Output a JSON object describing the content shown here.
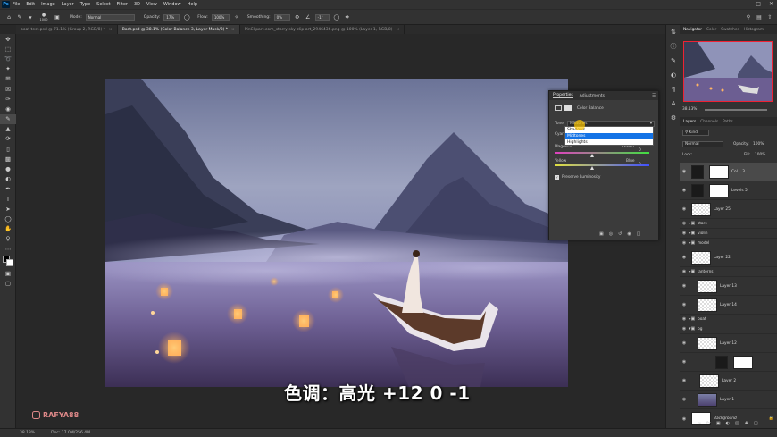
{
  "app": {
    "logo": "Ps"
  },
  "menu": [
    "File",
    "Edit",
    "Image",
    "Layer",
    "Type",
    "Select",
    "Filter",
    "3D",
    "View",
    "Window",
    "Help"
  ],
  "options": {
    "brush_size": "1000",
    "mode_label": "Mode:",
    "mode_value": "Normal",
    "opacity_label": "Opacity:",
    "opacity_value": "17%",
    "flow_label": "Flow:",
    "flow_value": "100%",
    "smoothing_label": "Smoothing:",
    "smoothing_value": "0%",
    "angle_value": "-1°"
  },
  "tabs": [
    {
      "label": "boat test.psd @ 71.1% (Group 2, RGB/8) *"
    },
    {
      "label": "Boat.psd @ 38.1% (Color Balance 3, Layer Mask/8) *"
    },
    {
      "label": "PinClipart.com_starry-sky-clip-art_2946436.png @ 100% (Layer 1, RGB/8)"
    }
  ],
  "properties": {
    "tab_properties": "Properties",
    "tab_adjustments": "Adjustments",
    "title": "Color Balance",
    "tone_label": "Tone:",
    "tone_value": "Midtones",
    "cyan": "Cyan",
    "red": "Red",
    "red_value": "",
    "magenta": "Magenta",
    "green": "Green",
    "green_value": "0",
    "yellow": "Yellow",
    "blue": "Blue",
    "blue_value": "0",
    "preserve": "Preserve Luminosity",
    "preserve_checked": true,
    "tone_options": [
      "Shadows",
      "Midtones",
      "Highlights"
    ]
  },
  "subtitle": "色调：高光 +12 0 -1",
  "watermark": "RAFYA88",
  "status": {
    "zoom": "38.13%",
    "doc": "Doc: 17.0M/256.4M"
  },
  "navigator": {
    "tabs": [
      "Navigator",
      "Color",
      "Swatches",
      "Histogram"
    ],
    "zoom": "38.13%"
  },
  "layers_panel": {
    "tabs": [
      "Layers",
      "Channels",
      "Paths"
    ],
    "kind": "Kind",
    "blend": "Normal",
    "opacity_label": "Opacity:",
    "opacity": "100%",
    "lock_label": "Lock:",
    "fill_label": "Fill:",
    "fill": "100%",
    "layers": [
      {
        "name": "Col... 3",
        "type": "adjust"
      },
      {
        "name": "Levels 5",
        "type": "adjust"
      },
      {
        "name": "Layer 25",
        "type": "layer"
      },
      {
        "name": "stars",
        "type": "group"
      },
      {
        "name": "violin",
        "type": "group"
      },
      {
        "name": "model",
        "type": "group"
      },
      {
        "name": "Layer 22",
        "type": "layer"
      },
      {
        "name": "lanterns",
        "type": "group"
      },
      {
        "name": "Layer 13",
        "type": "layer"
      },
      {
        "name": "Layer 14",
        "type": "layer"
      },
      {
        "name": "boat",
        "type": "group"
      },
      {
        "name": "bg",
        "type": "group"
      },
      {
        "name": "Layer 12",
        "type": "layer"
      },
      {
        "name": "",
        "type": "adjust"
      },
      {
        "name": "Layer 2",
        "type": "layer"
      },
      {
        "name": "Layer 1",
        "type": "layer"
      },
      {
        "name": "Background",
        "type": "bg"
      }
    ]
  }
}
